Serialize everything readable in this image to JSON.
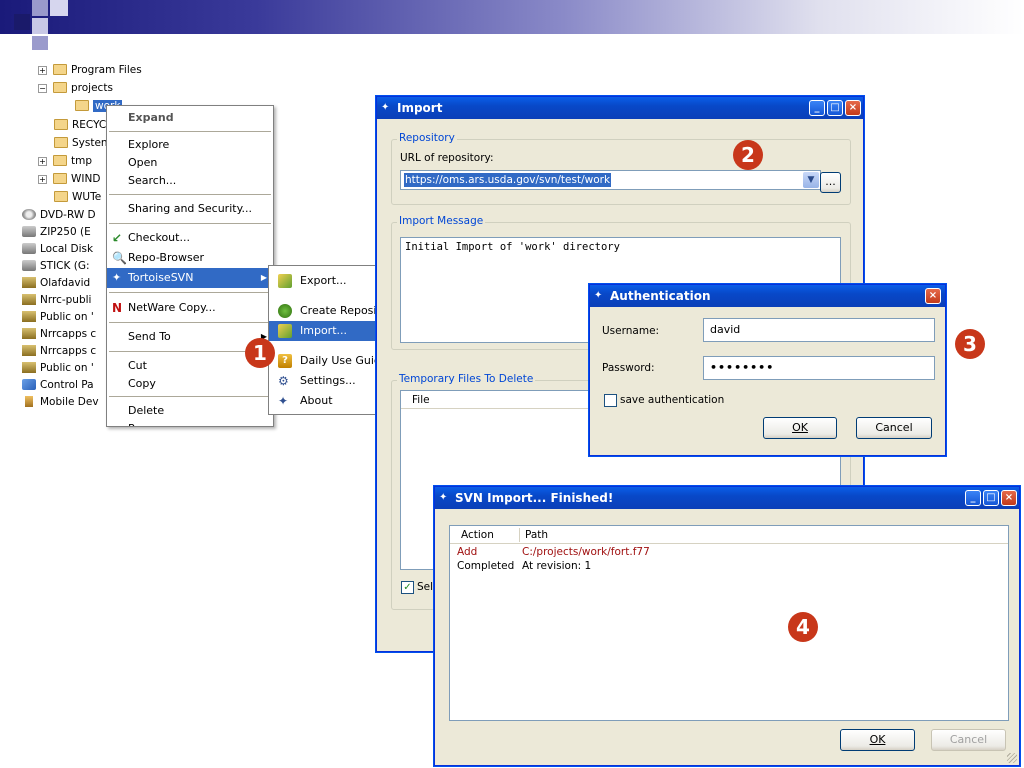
{
  "explorer": {
    "tree": [
      {
        "label": "Program Files",
        "prefix": "plus"
      },
      {
        "label": "projects",
        "prefix": "minus"
      },
      {
        "label": "work",
        "prefix": "none",
        "selected": true
      },
      {
        "label": "RECYC",
        "prefix": "none"
      },
      {
        "label": "Systen",
        "prefix": "none"
      },
      {
        "label": "tmp",
        "prefix": "plus"
      },
      {
        "label": "WIND",
        "prefix": "plus"
      },
      {
        "label": "WUTe",
        "prefix": "none"
      },
      {
        "label": "DVD-RW D"
      },
      {
        "label": "ZIP250 (E"
      },
      {
        "label": "Local Disk"
      },
      {
        "label": "STICK (G:"
      },
      {
        "label": "Olafdavid"
      },
      {
        "label": "Nrrc-publi"
      },
      {
        "label": "Public on '"
      },
      {
        "label": "Nrrcapps c"
      },
      {
        "label": "Nrrcapps c"
      },
      {
        "label": "Public on '"
      },
      {
        "label": "Control Pa"
      },
      {
        "label": "Mobile Dev"
      }
    ]
  },
  "context_menu": {
    "items": [
      "Expand",
      "Explore",
      "Open",
      "Search...",
      "Sharing and Security...",
      "Checkout...",
      "Repo-Browser",
      "TortoiseSVN",
      "NetWare Copy...",
      "Send To",
      "Cut",
      "Copy",
      "Delete",
      "Rename"
    ]
  },
  "submenu": {
    "items": [
      "Export...",
      "Create Reposit",
      "Import...",
      "Daily Use Guide",
      "Settings...",
      "About"
    ]
  },
  "import_dialog": {
    "title": "Import",
    "repository_legend": "Repository",
    "url_label": "URL of repository:",
    "url_value": "https://oms.ars.usda.gov/svn/test/work",
    "browse_label": "...",
    "message_legend": "Import Message",
    "message_value": "Initial Import of 'work' directory",
    "temp_legend": "Temporary Files To Delete",
    "file_column": "File",
    "select_all_label": "Sel"
  },
  "auth_dialog": {
    "title": "Authentication",
    "username_label": "Username:",
    "username_value": "david",
    "password_label": "Password:",
    "password_value": "••••••••",
    "save_label": "save authentication",
    "ok_label": "OK",
    "cancel_label": "Cancel"
  },
  "finished_dialog": {
    "title": "SVN Import... Finished!",
    "col_action": "Action",
    "col_path": "Path",
    "rows": [
      {
        "action": "Add",
        "path": "C:/projects/work/fort.f77"
      },
      {
        "action": "Completed",
        "path": "At revision: 1"
      }
    ],
    "ok_label": "OK",
    "cancel_label": "Cancel"
  },
  "badges": [
    "1",
    "2",
    "3",
    "4"
  ],
  "colors": {
    "accent": "#316ac5",
    "badge": "#c8371a",
    "title_bar": "#0848c8",
    "add_text": "#a01010"
  }
}
